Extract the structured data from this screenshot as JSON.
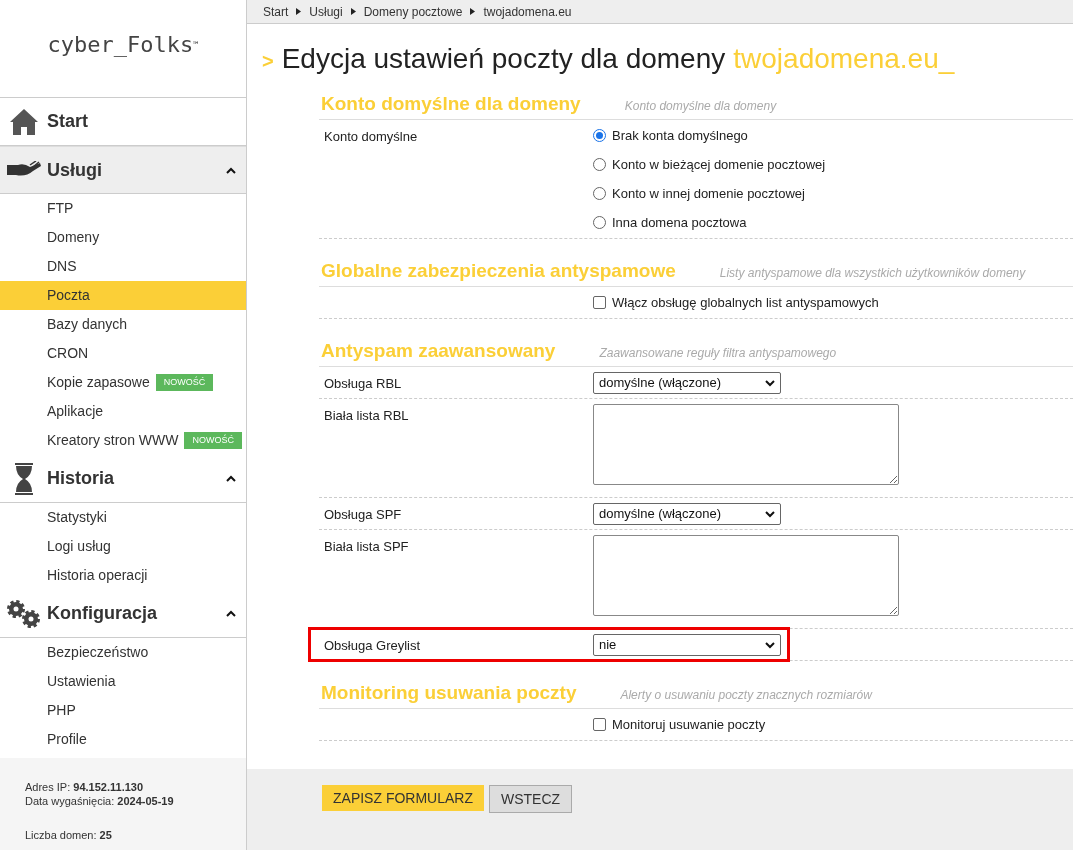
{
  "logo": {
    "text": "cyber_Folks",
    "mark": "™"
  },
  "sidebar": {
    "groups": [
      {
        "kind": "home",
        "label": "Start",
        "expanded": false
      },
      {
        "kind": "hand",
        "label": "Usługi",
        "expanded": true,
        "items": [
          {
            "label": "FTP",
            "selected": false
          },
          {
            "label": "Domeny",
            "selected": false
          },
          {
            "label": "DNS",
            "selected": false
          },
          {
            "label": "Poczta",
            "selected": true
          },
          {
            "label": "Bazy danych",
            "selected": false
          },
          {
            "label": "CRON",
            "selected": false
          },
          {
            "label": "Kopie zapasowe",
            "selected": false,
            "badge": "NOWOŚĆ"
          },
          {
            "label": "Aplikacje",
            "selected": false
          },
          {
            "label": "Kreatory stron WWW",
            "selected": false,
            "badge": "NOWOŚĆ"
          }
        ]
      },
      {
        "kind": "hourglass",
        "label": "Historia",
        "expanded": true,
        "items": [
          {
            "label": "Statystyki",
            "selected": false
          },
          {
            "label": "Logi usług",
            "selected": false
          },
          {
            "label": "Historia operacji",
            "selected": false
          }
        ]
      },
      {
        "kind": "gears",
        "label": "Konfiguracja",
        "expanded": true,
        "items": [
          {
            "label": "Bezpieczeństwo",
            "selected": false
          },
          {
            "label": "Ustawienia",
            "selected": false
          },
          {
            "label": "PHP",
            "selected": false
          },
          {
            "label": "Profile",
            "selected": false
          }
        ]
      }
    ],
    "info": [
      [
        "Adres IP: **94.152.11.130**",
        "Data wygaśnięcia: **2024-05-19**"
      ],
      [
        "Liczba domen: **25**"
      ]
    ]
  },
  "breadcrumb": [
    "Start",
    "Usługi",
    "Domeny pocztowe",
    "twojadomena.eu"
  ],
  "title": {
    "prefix": ">",
    "text": "Edycja ustawień poczty dla domeny",
    "domain": "twojadomena.eu_"
  },
  "sections": [
    {
      "title": "Konto domyślne dla domeny",
      "hint": "Konto domyślne dla domeny",
      "rows": [
        {
          "kind": "radio",
          "label": "Konto domyślne",
          "options": [
            {
              "label": "Brak konta domyślnego",
              "selected": true
            },
            {
              "label": "Konto w bieżącej domenie pocztowej",
              "selected": false
            },
            {
              "label": "Konto w innej domenie pocztowej",
              "selected": false
            },
            {
              "label": "Inna domena pocztowa",
              "selected": false
            }
          ]
        }
      ]
    },
    {
      "title": "Globalne zabezpieczenia antyspamowe",
      "hint": "Listy antyspamowe dla wszystkich użytkowników domeny",
      "rows": [
        {
          "kind": "checkbox",
          "text": "Włącz obsługę globalnych list antyspamowych",
          "checked": false
        }
      ]
    },
    {
      "title": "Antyspam zaawansowany",
      "hint": "Zaawansowane reguły filtra antyspamowego",
      "rows": [
        {
          "kind": "select",
          "label": "Obsługa RBL",
          "value": "domyślne (włączone)",
          "highlighted": false
        },
        {
          "kind": "textarea",
          "label": "Biała lista RBL"
        },
        {
          "kind": "select",
          "label": "Obsługa SPF",
          "value": "domyślne (włączone)",
          "highlighted": false
        },
        {
          "kind": "textarea",
          "label": "Biała lista SPF"
        },
        {
          "kind": "select",
          "label": "Obsługa Greylist",
          "value": "nie",
          "highlighted": true
        }
      ]
    },
    {
      "title": "Monitoring usuwania poczty",
      "hint": "Alerty o usuwaniu poczty znacznych rozmiarów",
      "rows": [
        {
          "kind": "checkbox",
          "text": "Monitoruj usuwanie poczty",
          "checked": false
        }
      ]
    }
  ],
  "buttons": [
    {
      "kind": "primary",
      "label": "ZAPISZ FORMULARZ"
    },
    {
      "kind": "secondary",
      "label": "WSTECZ"
    }
  ]
}
